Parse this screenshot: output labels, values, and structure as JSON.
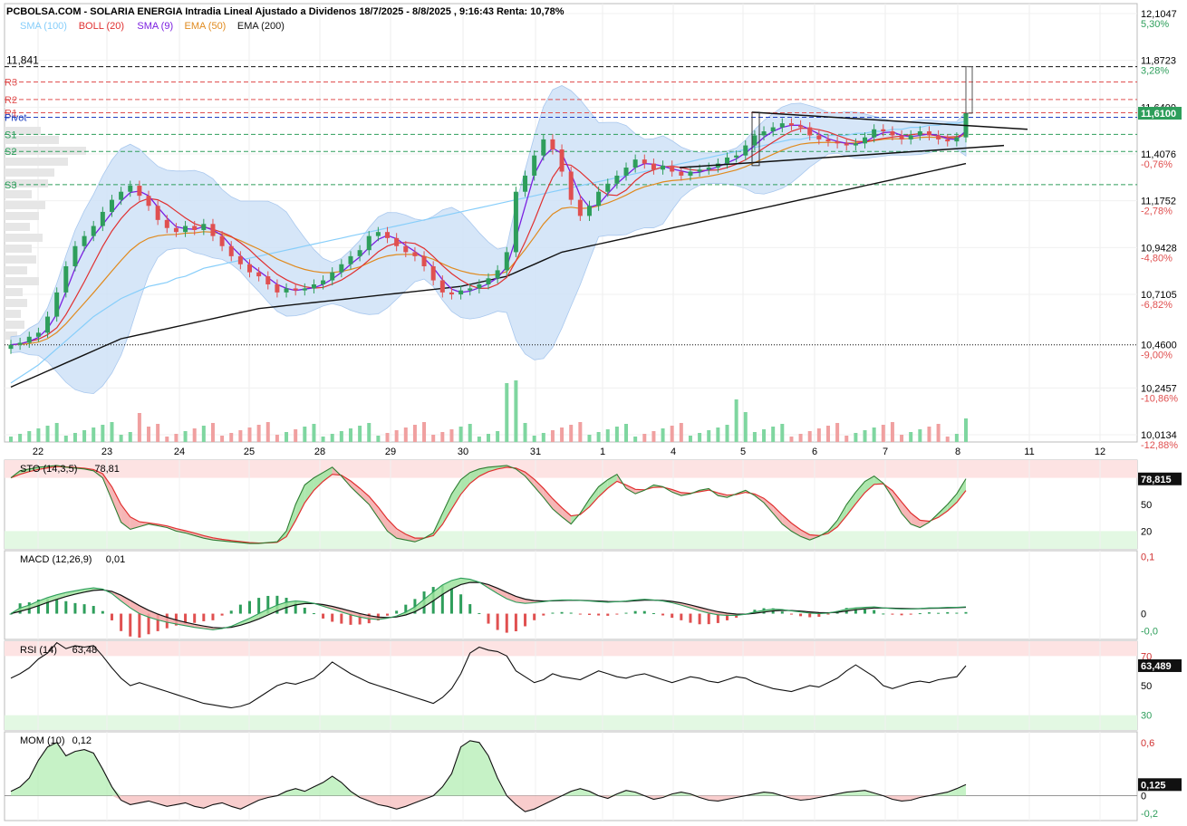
{
  "header": {
    "title": "PCBOLSA.COM - SOLARIA ENERGIA Intradia Lineal Ajustado a Dividenos 18/7/2025 - 8/8/2025 , 9:16:43 Renta: 10,78%",
    "legend": [
      {
        "label": "SMA (100)",
        "color": "#87cefa"
      },
      {
        "label": "BOLL (20)",
        "color": "#e03030"
      },
      {
        "label": "SMA (9)",
        "color": "#7b1fe0"
      },
      {
        "label": "EMA (50)",
        "color": "#e08a1e"
      },
      {
        "label": "EMA (200)",
        "color": "#111111"
      }
    ]
  },
  "chart_data": [
    {
      "type": "candlestick",
      "name": "price",
      "x_ticks": [
        "22",
        "23",
        "24",
        "25",
        "28",
        "29",
        "30",
        "31",
        "1",
        "4",
        "5",
        "6",
        "7",
        "8",
        "11",
        "12"
      ],
      "ylim": [
        10.0134,
        12.1047
      ],
      "price_ticks": [
        {
          "value": 12.1047,
          "label": "12,1047",
          "pct": "5,30%"
        },
        {
          "value": 11.8723,
          "label": "11,8723",
          "pct": "3,28%"
        },
        {
          "value": 11.64,
          "label": "11,6400",
          "pct": ""
        },
        {
          "value": 11.4076,
          "label": "11,4076",
          "pct": "-0,76%"
        },
        {
          "value": 11.1752,
          "label": "11,1752",
          "pct": "-2,78%"
        },
        {
          "value": 10.9428,
          "label": "10,9428",
          "pct": "-4,80%"
        },
        {
          "value": 10.7105,
          "label": "10,7105",
          "pct": "-6,82%"
        },
        {
          "value": 10.46,
          "label": "10,4600",
          "pct": "-9,00%"
        },
        {
          "value": 10.2457,
          "label": "10,2457",
          "pct": "-10,86%"
        },
        {
          "value": 10.0134,
          "label": "10,0134",
          "pct": "-12,88%"
        }
      ],
      "last_price": {
        "value": 11.61,
        "label": "11,6100",
        "color": "#2e9e5b"
      },
      "high_line": {
        "value": 11.841,
        "label": "11,841"
      },
      "pivots": [
        {
          "label": "R3",
          "value": 11.765,
          "color": "#e05050"
        },
        {
          "label": "R2",
          "value": 11.678,
          "color": "#e05050"
        },
        {
          "label": "R1",
          "value": 11.612,
          "color": "#e05050"
        },
        {
          "label": "Pivot",
          "value": 11.59,
          "color": "#2040c0"
        },
        {
          "label": "S1",
          "value": 11.505,
          "color": "#2e9e5b"
        },
        {
          "label": "S2",
          "value": 11.42,
          "color": "#2e9e5b"
        },
        {
          "label": "S3",
          "value": 11.255,
          "color": "#2e9e5b"
        }
      ],
      "series": {
        "close": [
          10.46,
          10.47,
          10.5,
          10.52,
          10.6,
          10.72,
          10.85,
          10.95,
          11.0,
          11.05,
          11.12,
          11.18,
          11.22,
          11.25,
          11.2,
          11.15,
          11.08,
          11.04,
          11.02,
          11.05,
          11.03,
          11.06,
          11.0,
          10.95,
          10.9,
          10.86,
          10.82,
          10.8,
          10.76,
          10.72,
          10.74,
          10.73,
          10.74,
          10.76,
          10.78,
          10.82,
          10.86,
          10.9,
          10.93,
          11.0,
          11.02,
          10.99,
          10.95,
          10.92,
          10.9,
          10.85,
          10.78,
          10.72,
          10.71,
          10.73,
          10.74,
          10.76,
          10.79,
          10.83,
          10.92,
          11.22,
          11.3,
          11.4,
          11.48,
          11.43,
          11.32,
          11.18,
          11.1,
          11.15,
          11.22,
          11.26,
          11.3,
          11.34,
          11.38,
          11.36,
          11.33,
          11.35,
          11.32,
          11.3,
          11.32,
          11.33,
          11.34,
          11.36,
          11.39,
          11.4,
          11.45,
          11.5,
          11.52,
          11.54,
          11.56,
          11.55,
          11.54,
          11.5,
          11.48,
          11.47,
          11.46,
          11.45,
          11.46,
          11.49,
          11.53,
          11.52,
          11.5,
          11.48,
          11.5,
          11.52,
          11.5,
          11.48,
          11.47,
          11.49,
          11.61
        ],
        "sma100": [
          10.27,
          10.3,
          10.33,
          10.36,
          10.4,
          10.44,
          10.48,
          10.52,
          10.56,
          10.6,
          10.63,
          10.66,
          10.69,
          10.71,
          10.73,
          10.75,
          10.76,
          10.77,
          10.79,
          10.8,
          10.82,
          10.84,
          10.85,
          10.86,
          10.87,
          10.88,
          10.89,
          10.9,
          10.91,
          10.92,
          10.93,
          10.94,
          10.95,
          10.96,
          10.97,
          10.98,
          10.99,
          11.0,
          11.01,
          11.02,
          11.03,
          11.04,
          11.05,
          11.06,
          11.07,
          11.08,
          11.09,
          11.1,
          11.11,
          11.12,
          11.13,
          11.14,
          11.15,
          11.16,
          11.17,
          11.18,
          11.19,
          11.2,
          11.21,
          11.22,
          11.23,
          11.24,
          11.25,
          11.26,
          11.27,
          11.28,
          11.29,
          11.3,
          11.31,
          11.32,
          11.33,
          11.34,
          11.35,
          11.36,
          11.37,
          11.38,
          11.39,
          11.4,
          11.41,
          11.42,
          11.43,
          11.44,
          11.45,
          11.46,
          11.47,
          11.48,
          11.48,
          11.49,
          11.49,
          11.5,
          11.5,
          11.5,
          11.51,
          11.51,
          11.52,
          11.52,
          11.53,
          11.53,
          11.54,
          11.54,
          11.55,
          11.55,
          11.56,
          11.56,
          11.57
        ],
        "ema200": [
          10.25,
          10.27,
          10.29,
          10.31,
          10.33,
          10.35,
          10.37,
          10.39,
          10.41,
          10.43,
          10.45,
          10.47,
          10.49,
          10.5,
          10.51,
          10.52,
          10.53,
          10.54,
          10.55,
          10.56,
          10.57,
          10.58,
          10.59,
          10.6,
          10.61,
          10.62,
          10.63,
          10.64,
          10.645,
          10.65,
          10.655,
          10.66,
          10.665,
          10.67,
          10.675,
          10.68,
          10.685,
          10.69,
          10.695,
          10.7,
          10.705,
          10.71,
          10.715,
          10.72,
          10.725,
          10.73,
          10.735,
          10.74,
          10.745,
          10.75,
          10.76,
          10.77,
          10.78,
          10.79,
          10.8,
          10.82,
          10.84,
          10.86,
          10.88,
          10.9,
          10.92,
          10.93,
          10.94,
          10.95,
          10.96,
          10.97,
          10.98,
          10.99,
          11.0,
          11.01,
          11.02,
          11.03,
          11.04,
          11.05,
          11.06,
          11.07,
          11.08,
          11.09,
          11.1,
          11.11,
          11.12,
          11.13,
          11.14,
          11.15,
          11.16,
          11.17,
          11.18,
          11.19,
          11.2,
          11.21,
          11.22,
          11.23,
          11.24,
          11.25,
          11.26,
          11.27,
          11.28,
          11.29,
          11.3,
          11.31,
          11.32,
          11.33,
          11.34,
          11.35,
          11.36
        ]
      }
    },
    {
      "type": "line",
      "name": "STO (14,3,5)",
      "label": "STO (14,3,5)",
      "last_text": "78,81",
      "last_value": 78.815,
      "last_label": "78,815",
      "ticks": [
        {
          "value": 50,
          "label": "50"
        },
        {
          "value": 20,
          "label": "20"
        }
      ],
      "ylim": [
        0,
        100
      ],
      "bands": {
        "upper": 80,
        "lower": 20
      },
      "series": [
        80,
        88,
        90,
        92,
        93,
        94,
        92,
        91,
        90,
        88,
        80,
        55,
        30,
        22,
        25,
        28,
        26,
        24,
        20,
        18,
        15,
        12,
        10,
        9,
        8,
        7,
        6,
        6,
        7,
        8,
        20,
        50,
        72,
        80,
        86,
        92,
        82,
        70,
        60,
        50,
        35,
        20,
        12,
        10,
        8,
        12,
        18,
        40,
        62,
        78,
        86,
        90,
        92,
        93,
        94,
        90,
        82,
        70,
        58,
        45,
        36,
        28,
        40,
        56,
        70,
        78,
        84,
        68,
        62,
        66,
        72,
        70,
        64,
        60,
        62,
        66,
        68,
        60,
        58,
        62,
        66,
        60,
        52,
        40,
        28,
        20,
        14,
        10,
        14,
        20,
        32,
        50,
        64,
        76,
        82,
        74,
        58,
        40,
        28,
        24,
        30,
        40,
        50,
        62,
        79
      ]
    },
    {
      "type": "line",
      "name": "MACD (12,26,9)",
      "label": "MACD (12,26,9)",
      "last_text": "0,01",
      "ticks": [
        {
          "value": 0.1,
          "label": "0,1",
          "color": "#d03030"
        },
        {
          "value": 0,
          "label": "0",
          "color": "#000000"
        },
        {
          "value": -0.03,
          "label": "-0,0",
          "color": "#2e9e5b"
        }
      ],
      "ylim": [
        -0.045,
        0.11
      ],
      "series": [
        0.0,
        0.01,
        0.015,
        0.022,
        0.028,
        0.033,
        0.037,
        0.04,
        0.043,
        0.045,
        0.043,
        0.035,
        0.022,
        0.01,
        0.0,
        -0.006,
        -0.011,
        -0.015,
        -0.018,
        -0.021,
        -0.024,
        -0.026,
        -0.028,
        -0.026,
        -0.022,
        -0.015,
        -0.008,
        0.0,
        0.008,
        0.015,
        0.02,
        0.022,
        0.021,
        0.018,
        0.013,
        0.008,
        0.003,
        -0.002,
        -0.006,
        -0.009,
        -0.01,
        -0.008,
        -0.004,
        0.003,
        0.012,
        0.025,
        0.038,
        0.05,
        0.058,
        0.062,
        0.06,
        0.055,
        0.045,
        0.035,
        0.026,
        0.02,
        0.018,
        0.019,
        0.021,
        0.023,
        0.024,
        0.024,
        0.023,
        0.022,
        0.021,
        0.02,
        0.021,
        0.022,
        0.024,
        0.025,
        0.024,
        0.022,
        0.019,
        0.015,
        0.01,
        0.005,
        0.001,
        -0.002,
        -0.003,
        -0.003,
        -0.001,
        0.003,
        0.006,
        0.008,
        0.007,
        0.005,
        0.003,
        0.001,
        0.0,
        0.001,
        0.004,
        0.008,
        0.01,
        0.011,
        0.012,
        0.01,
        0.009,
        0.008,
        0.008,
        0.009,
        0.01,
        0.01,
        0.011,
        0.011,
        0.012
      ]
    },
    {
      "type": "line",
      "name": "RSI (14)",
      "label": "RSI (14)",
      "last_text": "63,48",
      "last_value": 63.489,
      "last_label": "63,489",
      "ticks": [
        {
          "value": 70,
          "label": "70",
          "color": "#d03030"
        },
        {
          "value": 50,
          "label": "50",
          "color": "#000000"
        },
        {
          "value": 30,
          "label": "30",
          "color": "#2e9e5b"
        }
      ],
      "ylim": [
        20,
        80
      ],
      "bands": {
        "upper": 70,
        "lower": 30
      },
      "series": [
        55,
        58,
        62,
        68,
        72,
        79,
        75,
        77,
        76,
        77,
        70,
        62,
        55,
        50,
        52,
        50,
        48,
        46,
        44,
        42,
        40,
        38,
        37,
        36,
        35,
        36,
        38,
        42,
        46,
        50,
        52,
        51,
        53,
        55,
        60,
        66,
        62,
        58,
        55,
        52,
        50,
        48,
        46,
        44,
        42,
        40,
        38,
        42,
        48,
        58,
        72,
        76,
        74,
        73,
        70,
        60,
        56,
        52,
        54,
        58,
        56,
        55,
        54,
        57,
        60,
        58,
        56,
        55,
        57,
        58,
        56,
        54,
        52,
        54,
        56,
        55,
        53,
        52,
        54,
        56,
        55,
        52,
        50,
        48,
        47,
        46,
        48,
        50,
        49,
        52,
        55,
        60,
        64,
        60,
        56,
        50,
        48,
        50,
        52,
        53,
        52,
        54,
        55,
        56,
        63.5
      ]
    },
    {
      "type": "line",
      "name": "MOM (10)",
      "label": "MOM (10)",
      "last_text": "0,12",
      "last_value": 0.125,
      "last_label": "0,125",
      "ticks": [
        {
          "value": 0.6,
          "label": "0,6",
          "color": "#d03030"
        },
        {
          "value": 0,
          "label": "0",
          "color": "#000000"
        },
        {
          "value": -0.2,
          "label": "-0,2",
          "color": "#2e9e5b"
        }
      ],
      "ylim": [
        -0.28,
        0.72
      ],
      "series": [
        0.05,
        0.1,
        0.2,
        0.4,
        0.55,
        0.6,
        0.45,
        0.5,
        0.52,
        0.48,
        0.3,
        0.1,
        -0.05,
        -0.1,
        -0.08,
        -0.06,
        -0.09,
        -0.12,
        -0.1,
        -0.08,
        -0.12,
        -0.14,
        -0.1,
        -0.08,
        -0.12,
        -0.15,
        -0.1,
        -0.05,
        -0.02,
        0.0,
        0.05,
        0.08,
        0.05,
        0.1,
        0.15,
        0.22,
        0.15,
        0.05,
        -0.02,
        -0.06,
        -0.1,
        -0.12,
        -0.15,
        -0.12,
        -0.08,
        -0.04,
        0.0,
        0.1,
        0.25,
        0.55,
        0.62,
        0.6,
        0.45,
        0.2,
        0.0,
        -0.1,
        -0.18,
        -0.15,
        -0.1,
        -0.05,
        0.0,
        0.05,
        0.08,
        0.05,
        0.0,
        -0.03,
        0.02,
        0.06,
        0.04,
        0.0,
        -0.04,
        -0.02,
        0.02,
        0.04,
        0.02,
        -0.02,
        -0.05,
        -0.06,
        -0.04,
        -0.02,
        0.0,
        0.02,
        0.04,
        0.03,
        0.0,
        -0.03,
        -0.05,
        -0.04,
        -0.02,
        0.0,
        0.02,
        0.04,
        0.05,
        0.06,
        0.03,
        0.0,
        -0.04,
        -0.06,
        -0.05,
        -0.02,
        0.0,
        0.02,
        0.04,
        0.08,
        0.125
      ]
    }
  ]
}
